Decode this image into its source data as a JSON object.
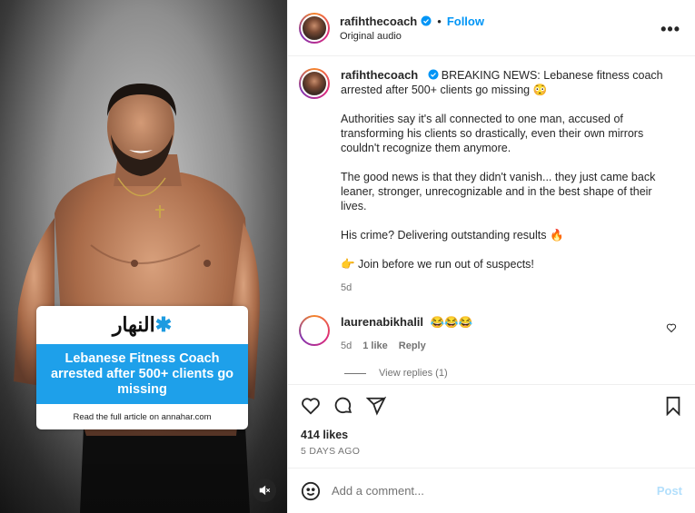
{
  "post": {
    "username": "rafihthecoach",
    "follow_label": "Follow",
    "separator": "•",
    "audio": "Original audio",
    "more_label": "•••",
    "caption": {
      "headline": "BREAKING NEWS: Lebanese fitness coach arrested after 500+ clients go missing 😳",
      "p2": "Authorities say it's all connected to one man, accused of transforming his clients so drastically, even their own mirrors couldn't recognize them anymore.",
      "p3": "The good news is that they didn't vanish... they just came back leaner, stronger, unrecognizable and in the best shape of their lives.",
      "p4": "His crime? Delivering outstanding results 🔥",
      "p5": "👉 Join before we run out of suspects!",
      "age": "5d"
    },
    "comment": {
      "username": "laurenabikhalil",
      "text": "😂😂😂",
      "age": "5d",
      "likes": "1 like",
      "reply_label": "Reply",
      "view_replies": "View replies (1)"
    },
    "likes_count": "414 likes",
    "posted_ago": "5 DAYS AGO",
    "comment_placeholder": "Add a comment...",
    "post_button": "Post"
  },
  "media": {
    "news_logo": "النهار",
    "news_headline": "Lebanese Fitness Coach arrested after 500+ clients go missing",
    "news_footer": "Read the full article on annahar.com",
    "mute_icon": "muted-speaker-icon"
  },
  "colors": {
    "accent": "#0095f6",
    "banner": "#1ea0ea",
    "post_disabled": "#b2dffc"
  }
}
